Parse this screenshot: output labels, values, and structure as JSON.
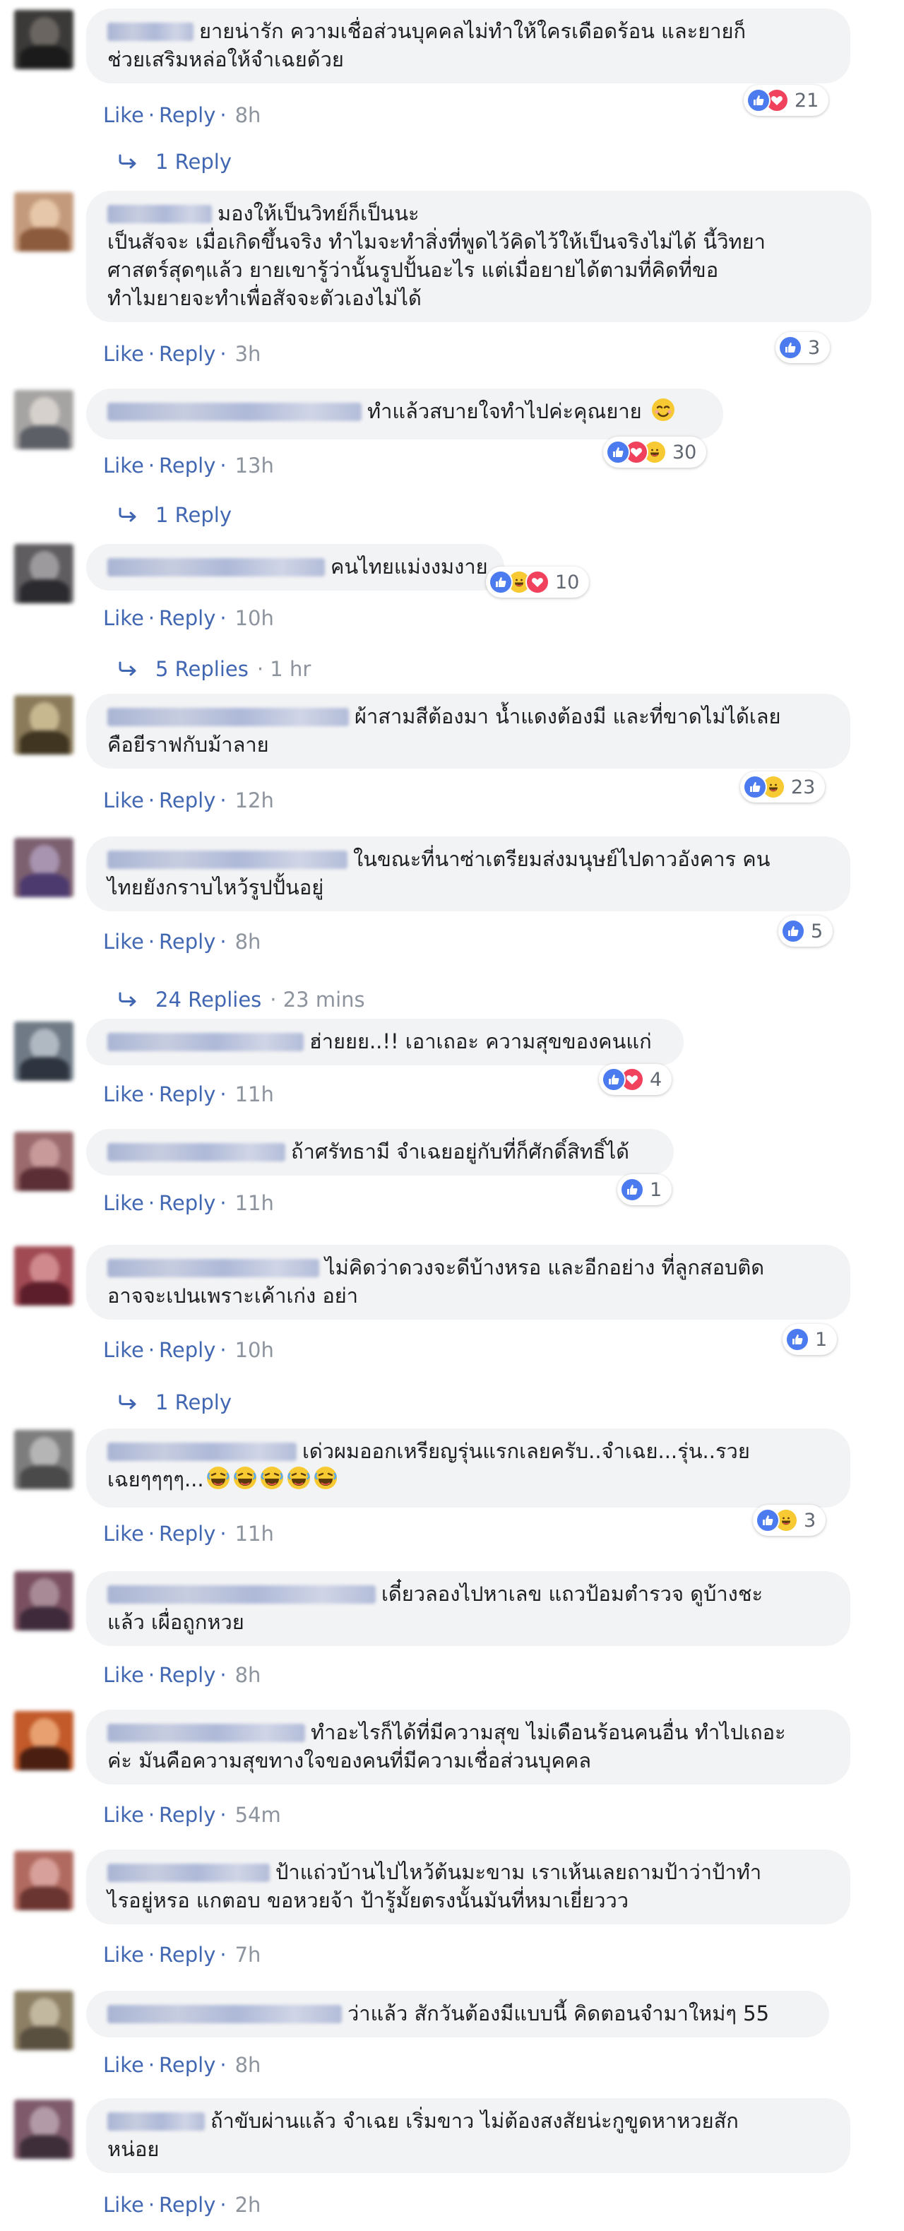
{
  "labels": {
    "like": "Like",
    "reply": "Reply"
  },
  "comments": [
    {
      "line1": "ยายน่ารัก ความเชื่อส่วนบุคคลไม่ทำให้ใครเดือดร้อน และยายก็",
      "line2": "ช่วยเสริมหล่อให้จำเฉยด้วย",
      "time": "8h",
      "reactions": [
        "like-icon",
        "love-icon"
      ],
      "count": "21",
      "replies": "1 Reply"
    },
    {
      "line1": "มองให้เป็นวิทย์ก็เป็นนะ",
      "line2": "เป็นสัจจะ เมื่อเกิดขึ้นจริง ทำไมจะทำสิ่งที่พูดไว้คิดไว้ให้เป็นจริงไม่ได้ นี้วิทยา",
      "line3": "ศาสตร์สุดๆแล้ว ยายเขารู้ว่านั้นรูปปั้นอะไร แต่เมื่อยายได้ตามที่คิดที่ขอ",
      "line4": "ทำไมยายจะทำเพื่อสัจจะตัวเองไม่ได้",
      "time": "3h",
      "reactions": [
        "like-icon"
      ],
      "count": "3"
    },
    {
      "line1": "ทำแล้วสบายใจทำไปค่ะคุณยาย",
      "time": "13h",
      "reactions": [
        "like-icon",
        "love-icon",
        "haha-icon"
      ],
      "count": "30",
      "replies": "1 Reply"
    },
    {
      "line1": "คนไทยแม่งงมงาย",
      "time": "10h",
      "reactions": [
        "like-icon",
        "haha-icon",
        "love-icon"
      ],
      "count": "10",
      "replies": "5 Replies",
      "replies_time": "1 hr"
    },
    {
      "line1": "ผ้าสามสีต้องมา น้ำแดงต้องมี และที่ขาดไม่ได้เลย",
      "line2": "คือยีราฟกับม้าลาย",
      "time": "12h",
      "reactions": [
        "like-icon",
        "haha-icon"
      ],
      "count": "23"
    },
    {
      "line1": "ในขณะที่นาซ่าเตรียมส่งมนุษย์ไปดาวอังคาร คน",
      "line2": "ไทยยังกราบไหว้รูปปั้นอยู่",
      "time": "8h",
      "reactions": [
        "like-icon"
      ],
      "count": "5",
      "replies": "24 Replies",
      "replies_time": "23 mins"
    },
    {
      "line1": "ฮ่ายยย..!! เอาเถอะ ความสุขของคนแก่",
      "time": "11h",
      "reactions": [
        "like-icon",
        "love-icon"
      ],
      "count": "4"
    },
    {
      "line1": "ถ้าศรัทธามี จำเฉยอยู่กับที่ก็ศักดิ์สิทธิ์ได้",
      "time": "11h",
      "reactions": [
        "like-icon"
      ],
      "count": "1"
    },
    {
      "line1": "ไม่คิดว่าดวงจะดีบ้างหรอ และอีกอย่าง ที่ลูกสอบติด",
      "line2": "อาจจะเปนเพราะเค้าเก่ง อย่า",
      "time": "10h",
      "reactions": [
        "like-icon"
      ],
      "count": "1",
      "replies": "1 Reply"
    },
    {
      "line1": "เด่วผมออกเหรียญรุ่นแรกเลยครับ..จำเฉย...รุ่น..รวย",
      "line2": "เฉยๆๆๆๆ...",
      "time": "11h",
      "reactions": [
        "like-icon",
        "haha-icon"
      ],
      "count": "3"
    },
    {
      "line1": "เดี๋ยวลองไปหาเลข แถวป้อมตำรวจ ดูบ้างชะ",
      "line2": "แล้ว เผื่อถูกหวย",
      "time": "8h"
    },
    {
      "line1": "ทำอะไรก็ได้ที่มีความสุข ไม่เดือนร้อนคนอื่น ทำไปเถอะ",
      "line2": "ค่ะ มันคือความสุขทางใจของคนที่มีความเชื่อส่วนบุคคล",
      "time": "54m"
    },
    {
      "line1": "ป้าแถ่วบ้านไปไหว้ต้นมะขาม เราเห้นเลยถามป้าว่าป้าทำ",
      "line2": "ไรอยู่หรอ แกตอบ ขอหวยจ้า ป้ารู้มั้ยตรงนั้นมันที่หมาเยี่ยววว",
      "time": "7h"
    },
    {
      "line1": "ว่าแล้ว สักวันต้องมีแบบนี้ คิดตอนจำมาใหม่ๆ 55",
      "time": "8h"
    },
    {
      "line1": "ถ้าขับผ่านแล้ว จำเฉย เริ่มขาว ไม่ต้องสงสัยน่ะกูขูดหาหวยสัก",
      "line2": "หน่อย",
      "time": "2h"
    }
  ]
}
